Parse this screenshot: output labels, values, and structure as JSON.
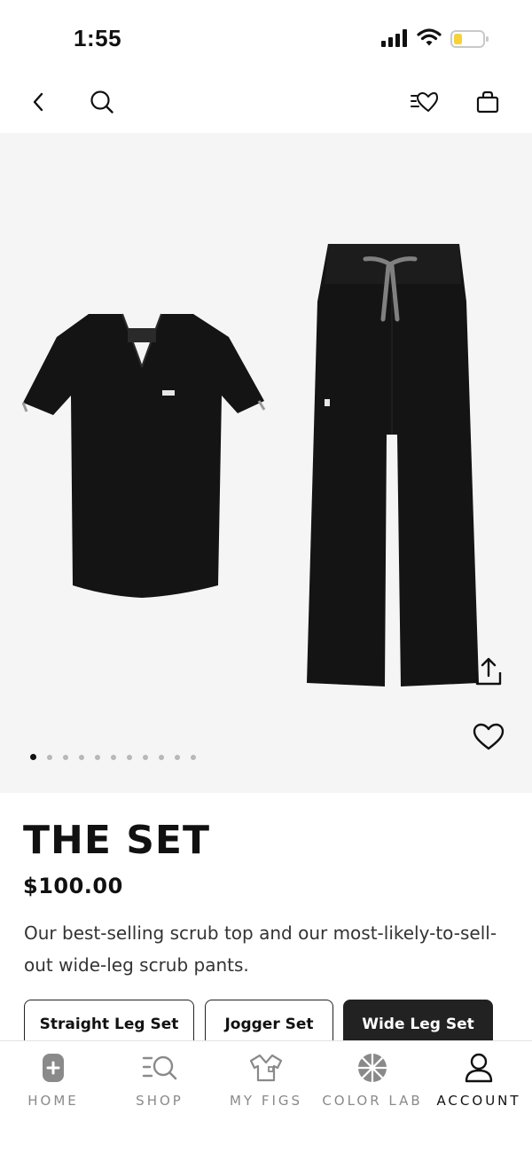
{
  "status_bar": {
    "time": "1:55"
  },
  "nav": {
    "icons": [
      "chevron-left-icon",
      "search-icon",
      "wishlist-icon",
      "shopping-bag-icon"
    ]
  },
  "gallery": {
    "images": [
      "scrub-top-image",
      "scrub-pants-image"
    ],
    "dot_count": 11,
    "active_dot": 0
  },
  "product": {
    "title": "THE SET",
    "price": "$100.00",
    "description": "Our best-selling scrub top and our most-likely-to-sell-out wide-leg scrub pants."
  },
  "variants": [
    {
      "label": "Straight Leg Set",
      "selected": false
    },
    {
      "label": "Jogger Set",
      "selected": false
    },
    {
      "label": "Wide Leg Set",
      "selected": true
    }
  ],
  "tabs": [
    {
      "label": "HOME",
      "icon": "home-icon"
    },
    {
      "label": "SHOP",
      "icon": "shop-icon"
    },
    {
      "label": "MY FIGS",
      "icon": "shirt-icon"
    },
    {
      "label": "COLOR LAB",
      "icon": "color-wheel-icon"
    },
    {
      "label": "ACCOUNT",
      "icon": "account-icon",
      "active": true
    }
  ],
  "colors": {
    "gallery_bg": "#f5f5f5",
    "selected_variant_bg": "#222222",
    "inactive_tab": "#8a8a8a",
    "battery_level": "#f5d23a"
  }
}
